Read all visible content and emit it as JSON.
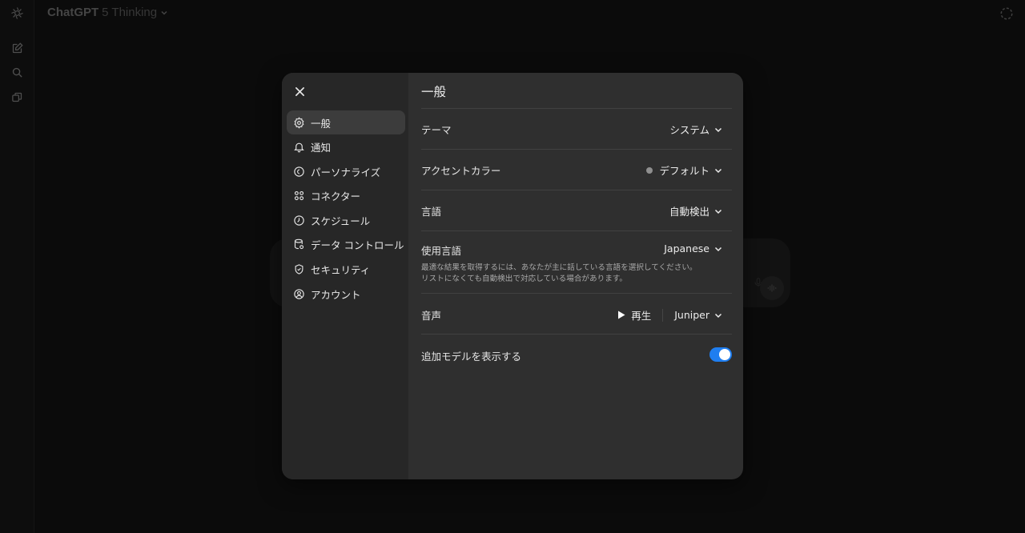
{
  "app": {
    "model_name": "ChatGPT",
    "model_variant": "5 Thinking"
  },
  "rail_icons": [
    "openai-logo-icon",
    "new-chat-icon",
    "search-icon",
    "library-icon"
  ],
  "settings": {
    "title": "一般",
    "nav": [
      {
        "label": "一般",
        "icon": "gear-icon",
        "active": true
      },
      {
        "label": "通知",
        "icon": "bell-icon"
      },
      {
        "label": "パーソナライズ",
        "icon": "personalize-icon"
      },
      {
        "label": "コネクター",
        "icon": "connectors-icon"
      },
      {
        "label": "スケジュール",
        "icon": "clock-icon"
      },
      {
        "label": "データ コントロール",
        "icon": "database-icon"
      },
      {
        "label": "セキュリティ",
        "icon": "shield-icon"
      },
      {
        "label": "アカウント",
        "icon": "account-icon"
      }
    ],
    "rows": {
      "theme": {
        "label": "テーマ",
        "value": "システム"
      },
      "accent": {
        "label": "アクセントカラー",
        "value": "デフォルト",
        "swatch": "#8f8f8f"
      },
      "language": {
        "label": "言語",
        "value": "自動検出"
      },
      "spoken": {
        "label": "使用言語",
        "value": "Japanese",
        "description": "最適な結果を取得するには、あなたが主に話している言語を選択してください。リストになくても自動検出で対応している場合があります。"
      },
      "voice": {
        "label": "音声",
        "play_label": "再生",
        "value": "Juniper"
      },
      "additional_models": {
        "label": "追加モデルを表示する",
        "enabled": true
      }
    }
  },
  "colors": {
    "toggle_on": "#1f7ef0",
    "modal_bg": "#2f2f2f",
    "sidebar_bg": "#272727"
  }
}
